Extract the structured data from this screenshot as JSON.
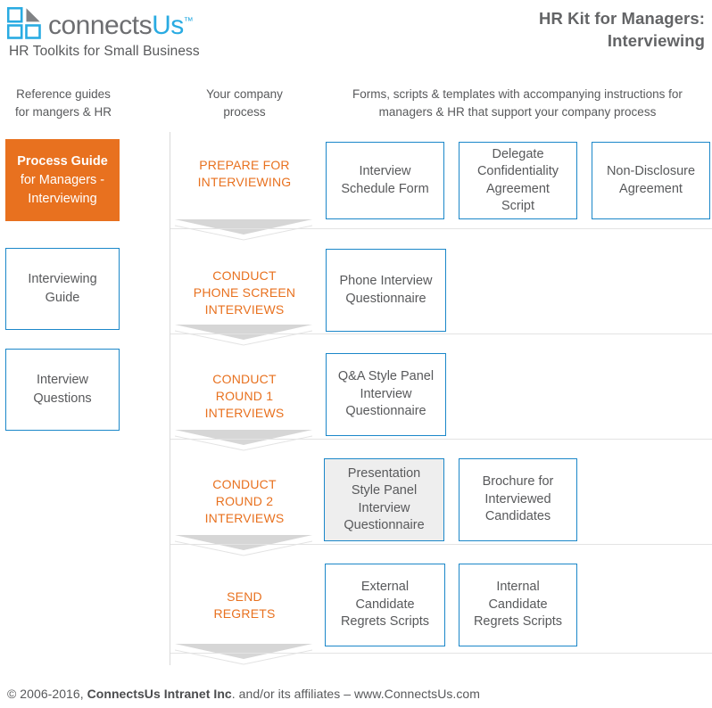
{
  "brand": {
    "logo_icon": "connectsus-squares-logo",
    "name_part1": "connects",
    "name_part2": "Us",
    "trademark": "™",
    "tagline": "HR Toolkits for Small Business"
  },
  "header": {
    "kit_title_line1": "HR Kit for Managers:",
    "kit_title_line2": "Interviewing"
  },
  "columns": {
    "left_heading_line1": "Reference guides",
    "left_heading_line2": "for mangers & HR",
    "center_heading_line1": "Your company",
    "center_heading_line2": "process",
    "right_heading_line1": "Forms, scripts & templates with accompanying instructions for",
    "right_heading_line2": "managers & HR that support your company process"
  },
  "reference_guides": [
    {
      "title_bold": "Process Guide",
      "title_rest_line1": "for Managers -",
      "title_rest_line2": "Interviewing",
      "style": "primary"
    },
    {
      "line1": "Interviewing",
      "line2": "Guide",
      "style": "doc"
    },
    {
      "line1": "Interview",
      "line2": "Questions",
      "style": "doc"
    }
  ],
  "process_steps": [
    {
      "lines": [
        "PREPARE FOR",
        "INTERVIEWING"
      ]
    },
    {
      "lines": [
        "CONDUCT",
        "PHONE SCREEN",
        "INTERVIEWS"
      ]
    },
    {
      "lines": [
        "CONDUCT",
        "ROUND 1",
        "INTERVIEWS"
      ]
    },
    {
      "lines": [
        "CONDUCT",
        "ROUND 2",
        "INTERVIEWS"
      ]
    },
    {
      "lines": [
        "SEND",
        "REGRETS"
      ]
    }
  ],
  "documents": [
    [
      {
        "lines": [
          "Interview",
          "Schedule Form"
        ],
        "shaded": false
      },
      {
        "lines": [
          "Delegate",
          "Confidentiality",
          "Agreement",
          "Script"
        ],
        "shaded": false
      },
      {
        "lines": [
          "Non-Disclosure",
          "Agreement"
        ],
        "shaded": false
      }
    ],
    [
      {
        "lines": [
          "Phone Interview",
          "Questionnaire"
        ],
        "shaded": false
      }
    ],
    [
      {
        "lines": [
          "Q&A Style Panel",
          "Interview",
          "Questionnaire"
        ],
        "shaded": false
      }
    ],
    [
      {
        "lines": [
          "Presentation",
          "Style Panel",
          "Interview",
          "Questionnaire"
        ],
        "shaded": true
      },
      {
        "lines": [
          "Brochure for",
          "Interviewed",
          "Candidates"
        ],
        "shaded": false
      }
    ],
    [
      {
        "lines": [
          "External",
          "Candidate",
          "Regrets Scripts"
        ],
        "shaded": false
      },
      {
        "lines": [
          "Internal",
          "Candidate",
          "Regrets Scripts"
        ],
        "shaded": false
      }
    ]
  ],
  "footer": {
    "prefix": "© 2006-2016, ",
    "company": "ConnectsUs Intranet Inc",
    "suffix": ". and/or its affiliates – www.ConnectsUs.com"
  },
  "colors": {
    "orange": "#e8711f",
    "blue": "#1b87c9",
    "logo_blue": "#29abe2",
    "text_gray": "#58595b",
    "shade_gray": "#eeeeee",
    "line_gray": "#e3e3e3"
  }
}
